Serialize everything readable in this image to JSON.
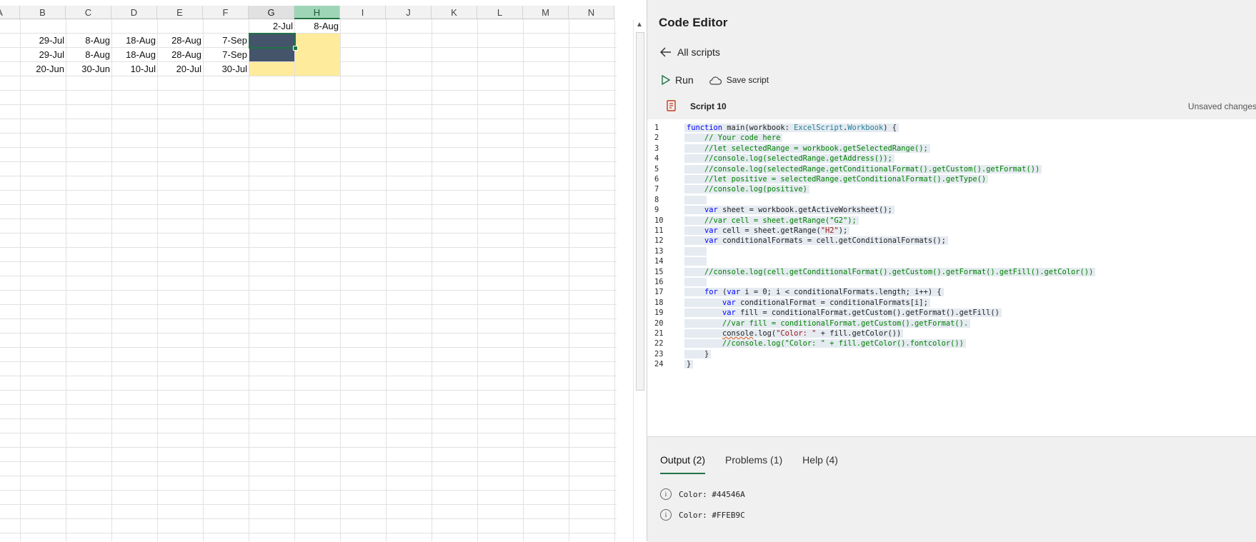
{
  "sheet": {
    "columns": [
      "A",
      "B",
      "C",
      "D",
      "E",
      "F",
      "G",
      "H",
      "I",
      "J",
      "K",
      "L",
      "M",
      "N"
    ],
    "header_row": {
      "G": "2-Jul",
      "H": "8-Aug"
    },
    "rows": [
      [
        "29-Jul",
        "8-Aug",
        "18-Aug",
        "28-Aug",
        "7-Sep"
      ],
      [
        "29-Jul",
        "8-Aug",
        "18-Aug",
        "28-Aug",
        "7-Sep"
      ],
      [
        "20-Jun",
        "30-Jun",
        "10-Jul",
        "20-Jul",
        "30-Jul"
      ]
    ],
    "fill_colors": {
      "dark": "#44546A",
      "yellow": "#FFEB9C"
    }
  },
  "editor": {
    "title": "Code Editor",
    "back_label": "All scripts",
    "run_label": "Run",
    "save_label": "Save script",
    "script_name": "Script 10",
    "status": "Unsaved changes"
  },
  "code_lines": [
    "function main(workbook: ExcelScript.Workbook) {",
    "    // Your code here",
    "    //let selectedRange = workbook.getSelectedRange();",
    "    //console.log(selectedRange.getAddress());",
    "    //console.log(selectedRange.getConditionalFormat().getCustom().getFormat())",
    "    //let positive = selectedRange.getConditionalFormat().getType()",
    "    //console.log(positive)",
    "",
    "    var sheet = workbook.getActiveWorksheet();",
    "    //var cell = sheet.getRange(\"G2\");",
    "    var cell = sheet.getRange(\"H2\");",
    "    var conditionalFormats = cell.getConditionalFormats();",
    "",
    "",
    "    //console.log(cell.getConditionalFormat().getCustom().getFormat().getFill().getColor())",
    "",
    "    for (var i = 0; i < conditionalFormats.length; i++) {",
    "        var conditionalFormat = conditionalFormats[i];",
    "        var fill = conditionalFormat.getCustom().getFormat().getFill()",
    "        //var fill = conditionalFormat.getCustom().getFormat().",
    "        console.log(\"Color: \" + fill.getColor())",
    "        //console.log(\"Color: \" + fill.getColor().fontcolor())",
    "    }",
    "}"
  ],
  "output": {
    "tabs": [
      "Output (2)",
      "Problems (1)",
      "Help (4)"
    ],
    "lines": [
      "Color: #44546A",
      "Color: #FFEB9C"
    ]
  }
}
